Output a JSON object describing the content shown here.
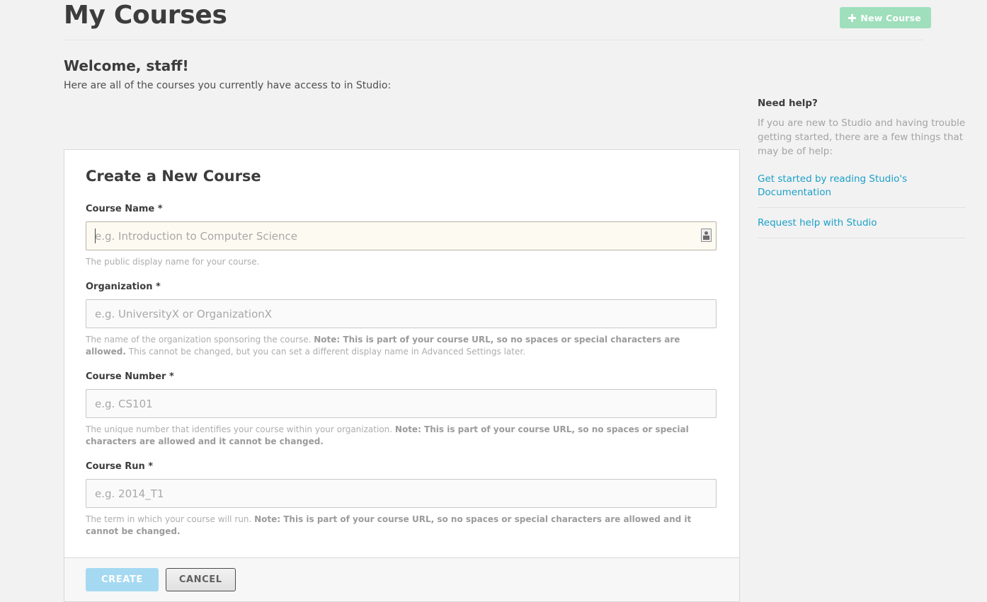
{
  "header": {
    "title": "My Courses",
    "new_course_label": "New Course",
    "new_course_icon": "plus-icon",
    "accent_green": "#9fdfbc"
  },
  "main": {
    "welcome_title": "Welcome, staff!",
    "welcome_subtitle": "Here are all of the courses you currently have access to in Studio:"
  },
  "form": {
    "title": "Create a New Course",
    "fields": [
      {
        "label": "Course Name *",
        "placeholder": "e.g. Introduction to Computer Science",
        "value": "",
        "help_before": "The public display name for your course.",
        "help_note": "",
        "help_after": "",
        "focused": true
      },
      {
        "label": "Organization *",
        "placeholder": "e.g. UniversityX or OrganizationX",
        "value": "",
        "help_before": "The name of the organization sponsoring the course. ",
        "help_note": "Note: This is part of your course URL, so no spaces or special characters are allowed.",
        "help_after": " This cannot be changed, but you can set a different display name in Advanced Settings later.",
        "focused": false
      },
      {
        "label": "Course Number *",
        "placeholder": "e.g. CS101",
        "value": "",
        "help_before": "The unique number that identifies your course within your organization. ",
        "help_note": "Note: This is part of your course URL, so no spaces or special characters are allowed and it cannot be changed.",
        "help_after": "",
        "focused": false
      },
      {
        "label": "Course Run *",
        "placeholder": "e.g. 2014_T1",
        "value": "",
        "help_before": "The term in which your course will run. ",
        "help_note": "Note: This is part of your course URL, so no spaces or special characters are allowed and it cannot be changed.",
        "help_after": "",
        "focused": false
      }
    ],
    "create_label": "CREATE",
    "cancel_label": "CANCEL",
    "create_color": "#a5d9f2"
  },
  "sidebar": {
    "title": "Need help?",
    "text": "If you are new to Studio and having trouble getting started, there are a few things that may be of help:",
    "links": [
      {
        "label": "Get started by reading Studio's Documentation"
      },
      {
        "label": "Request help with Studio"
      }
    ],
    "link_color": "#1ba0c8"
  }
}
